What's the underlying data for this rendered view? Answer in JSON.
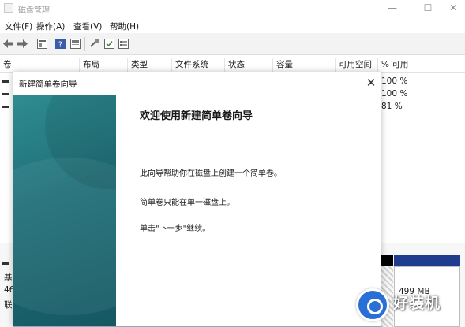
{
  "window": {
    "title": "磁盘管理",
    "controls": {
      "minimize": "—",
      "maximize": "☐",
      "close": "✕"
    }
  },
  "menu": {
    "items": [
      "文件(F)",
      "操作(A)",
      "查看(V)",
      "帮助(H)"
    ]
  },
  "toolbar": {
    "buttons": [
      "back-icon",
      "forward-icon",
      "properties-icon",
      "help-icon",
      "refresh-icon",
      "connect-icon",
      "check-icon",
      "list-icon"
    ]
  },
  "volume_table": {
    "columns": [
      "卷",
      "布局",
      "类型",
      "文件系统",
      "状态",
      "容量",
      "可用空间",
      "% 可用"
    ],
    "rows": [
      {
        "percent_free": "100 %"
      },
      {
        "percent_free": "100 %"
      },
      {
        "percent_free": "81 %"
      }
    ]
  },
  "disk_map": {
    "disk_label_lines": [
      "基",
      "46",
      "联"
    ],
    "partition_size": "499 MB"
  },
  "wizard": {
    "title": "新建简单卷向导",
    "close_symbol": "✕",
    "heading": "欢迎使用新建简单卷向导",
    "paragraphs": [
      "此向导帮助你在磁盘上创建一个简单卷。",
      "简单卷只能在单一磁盘上。",
      "单击\"下一步\"继续。"
    ]
  },
  "watermark": {
    "text": "好装机"
  }
}
